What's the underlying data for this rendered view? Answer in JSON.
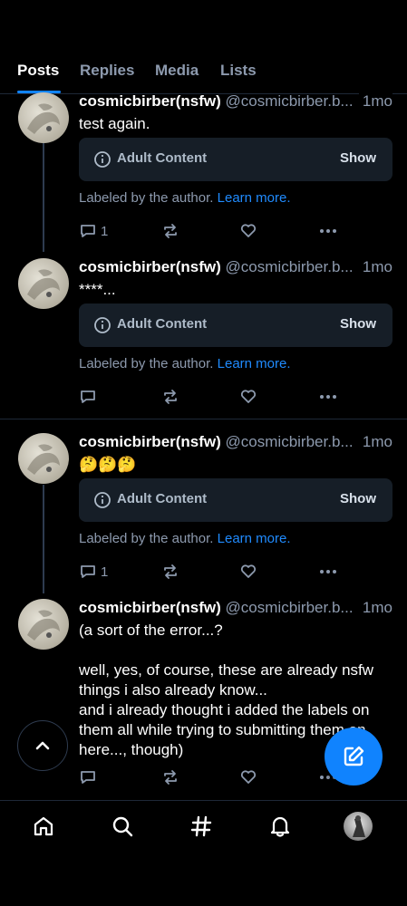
{
  "tabs": [
    {
      "label": "Posts",
      "active": true
    },
    {
      "label": "Replies",
      "active": false
    },
    {
      "label": "Media",
      "active": false
    },
    {
      "label": "Lists",
      "active": false
    }
  ],
  "posts": [
    {
      "name": "cosmicbirber(nsfw)",
      "handle": "@cosmicbirber.b...",
      "age": "1mo",
      "text": "test again.",
      "warning": {
        "label": "Adult Content",
        "show": "Show"
      },
      "labeled": {
        "text": "Labeled by the author.",
        "link": "Learn more."
      },
      "replies": "1"
    },
    {
      "name": "cosmicbirber(nsfw)",
      "handle": "@cosmicbirber.b...",
      "age": "1mo",
      "text": "****...",
      "warning": {
        "label": "Adult Content",
        "show": "Show"
      },
      "labeled": {
        "text": "Labeled by the author.",
        "link": "Learn more."
      },
      "replies": ""
    },
    {
      "name": "cosmicbirber(nsfw)",
      "handle": "@cosmicbirber.b...",
      "age": "1mo",
      "text": "🤔🤔🤔",
      "warning": {
        "label": "Adult Content",
        "show": "Show"
      },
      "labeled": {
        "text": "Labeled by the author.",
        "link": "Learn more."
      },
      "replies": "1"
    },
    {
      "name": "cosmicbirber(nsfw)",
      "handle": "@cosmicbirber.b...",
      "age": "1mo",
      "text": "(a sort of the error...?\n\nwell, yes, of course, these are already nsfw things i also already know...\n and i already thought i added the labels on them all while trying to submitting them on here..., though)"
    }
  ],
  "colors": {
    "accent": "#1083fe",
    "link": "#208bfe",
    "muted": "#8d9aae",
    "card": "#161e27"
  },
  "icons": {
    "nav": [
      "home-icon",
      "search-icon",
      "hashtag-icon",
      "bell-icon",
      "profile-avatar"
    ],
    "actions": [
      "reply-icon",
      "repost-icon",
      "like-icon",
      "more-icon"
    ],
    "fab": "compose-icon",
    "scroll": "chevron-up-icon"
  }
}
